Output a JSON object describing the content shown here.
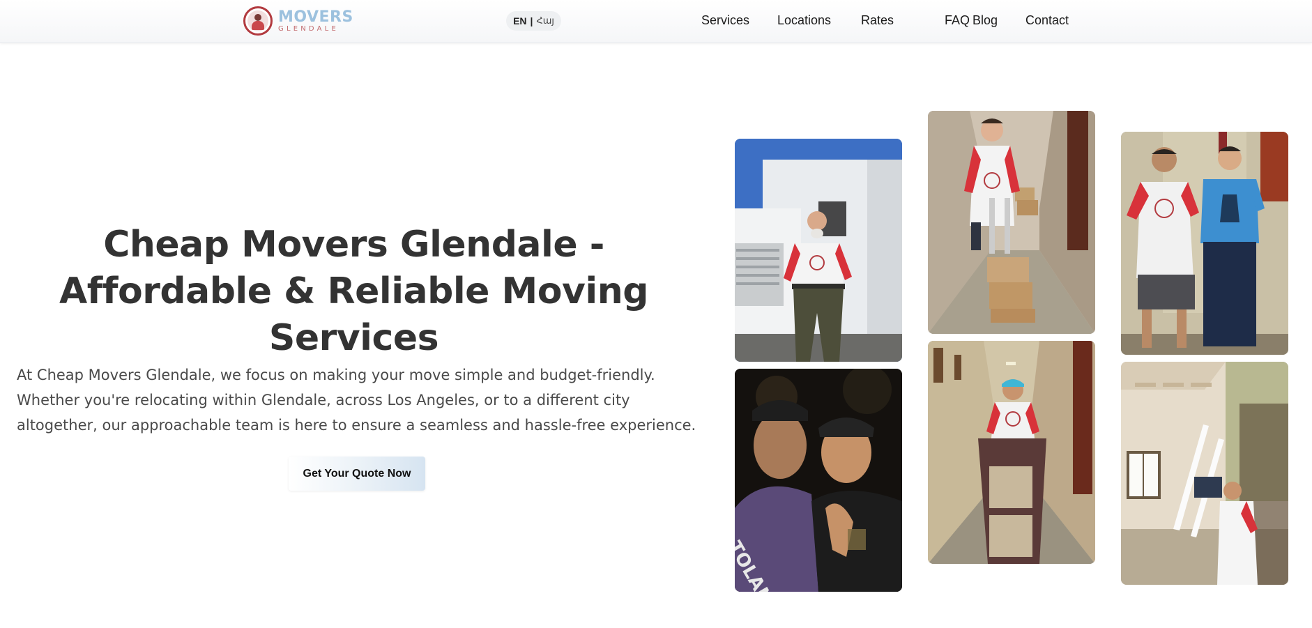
{
  "brand": {
    "name_line1": "MOVERS",
    "name_line2": "GLENDALE",
    "logo_icon": "mover-badge-icon"
  },
  "language": {
    "current": "EN",
    "separator": "|",
    "alternate": "Հայ"
  },
  "nav": {
    "items": [
      {
        "label": "Services"
      },
      {
        "label": "Locations"
      },
      {
        "label": "Rates"
      },
      {
        "label": "FAQ"
      },
      {
        "label": "Blog"
      },
      {
        "label": "Contact"
      }
    ]
  },
  "hero": {
    "title": "Cheap Movers Glendale - Affordable & Reliable Moving Services",
    "description": "At Cheap Movers Glendale, we focus on making your move simple and budget-friendly. Whether you're relocating within Glendale, across Los Angeles, or to a different city altogether, our approachable team is here to ensure a seamless and hassle-free experience.",
    "cta_label": "Get Your Quote Now"
  },
  "gallery": {
    "photos": [
      {
        "name": "photo-mover-with-truck"
      },
      {
        "name": "photo-night-selfie"
      },
      {
        "name": "photo-hallway-dolly"
      },
      {
        "name": "photo-hallway-cabinet"
      },
      {
        "name": "photo-two-men-thumbs-up"
      },
      {
        "name": "photo-moving-ladder"
      }
    ]
  },
  "colors": {
    "accent_red": "#b23a3f",
    "logo_blue": "#9cc1de",
    "text_dark": "#333333",
    "shirt_red": "#d8323a"
  }
}
